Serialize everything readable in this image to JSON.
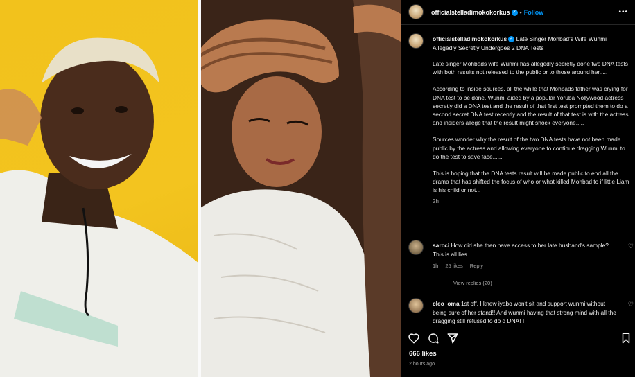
{
  "post": {
    "username": "officialstelladimokokorkus",
    "follow_label": "Follow",
    "separator": "•",
    "caption_title": "Late Singer Mohbad's Wife Wunmi Allegedly Secretly Undergoes 2 DNA Tests",
    "caption_paragraphs": [
      "Late singer Mohbads wife Wunmi has allegedly secretly done two DNA tests with both results not released to the public or to those around her.....",
      "According to inside sources, all the while that Mohbads father was crying for DNA test to be done, Wunmi aided by a popular Yoruba Nollywood actress secretly did a DNA test and the result of that first test prompted them to do a second secret DNA test recently and the result of that test is with the actress and insiders allege that the result might shock everyone.....",
      "Sources wonder why the result of the two DNA tests have not been made public by the actress and allowing everyone to continue dragging Wunmi to do the test to save face......",
      "This is hoping that the DNA tests result will be made public to end all the drama that has shifted the focus of who or what killed Mohbad to if little Liam is his child or not..."
    ],
    "caption_age": "2h",
    "likes": "666 likes",
    "posted": "2 hours ago"
  },
  "comments": [
    {
      "username": "sarcci",
      "text": "How did she then have access to her late husband's sample? This is all lies",
      "age": "1h",
      "likes": "25 likes",
      "reply": "Reply",
      "view_replies": "View replies (20)"
    },
    {
      "username": "cleo_oma",
      "text": "1st off, I knew iyabo won't sit and support wunmi without being sure of her stand!! And wunmi having that strong mind with all the dragging still refused to do d DNA! I"
    }
  ],
  "colors": {
    "accent": "#0095f6",
    "background": "#000000",
    "muted": "#a8a8a8"
  },
  "icons": [
    "verified-badge-icon",
    "more-icon",
    "heart-icon",
    "comment-icon",
    "share-icon",
    "bookmark-icon"
  ]
}
